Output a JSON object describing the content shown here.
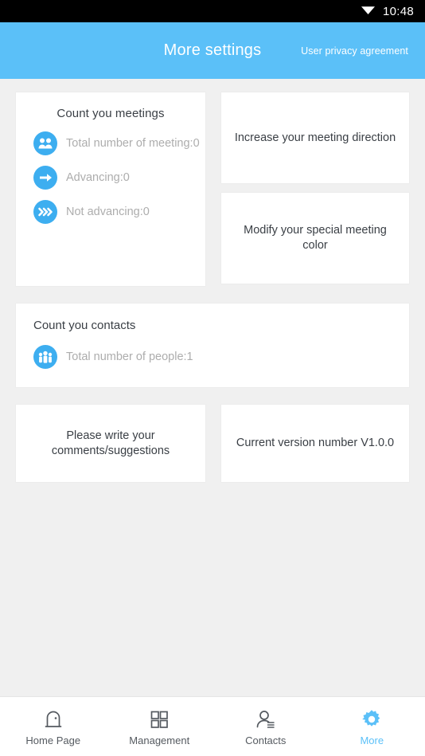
{
  "status_bar": {
    "wifi_icon": "wifi-icon",
    "time": "10:48"
  },
  "header": {
    "title": "More settings",
    "privacy_link": "User privacy agreement",
    "background_color": "#5bc0f8"
  },
  "meetings_card": {
    "title": "Count you meetings",
    "stats": [
      {
        "icon": "group-people-icon",
        "label": "Total number of meeting:0"
      },
      {
        "icon": "arrow-right-icon",
        "label": "Advancing:0"
      },
      {
        "icon": "double-chevron-right-icon",
        "label": "Not advancing:0"
      }
    ]
  },
  "action_cards": [
    {
      "label": "Increase your meeting direction"
    },
    {
      "label": "Modify your special meeting color"
    }
  ],
  "contacts_card": {
    "title": "Count you contacts",
    "stat": {
      "icon": "three-people-icon",
      "label": "Total number of people:1"
    }
  },
  "bottom_cards": [
    {
      "label": "Please write your comments/suggestions"
    },
    {
      "label": "Current version number V1.0.0"
    }
  ],
  "bottom_nav": {
    "active_color": "#5bc0f8",
    "items": [
      {
        "icon": "home-door-icon",
        "label": "Home Page",
        "active": false
      },
      {
        "icon": "grid-squares-icon",
        "label": "Management",
        "active": false
      },
      {
        "icon": "contact-person-icon",
        "label": "Contacts",
        "active": false
      },
      {
        "icon": "gear-icon",
        "label": "More",
        "active": true
      }
    ]
  }
}
